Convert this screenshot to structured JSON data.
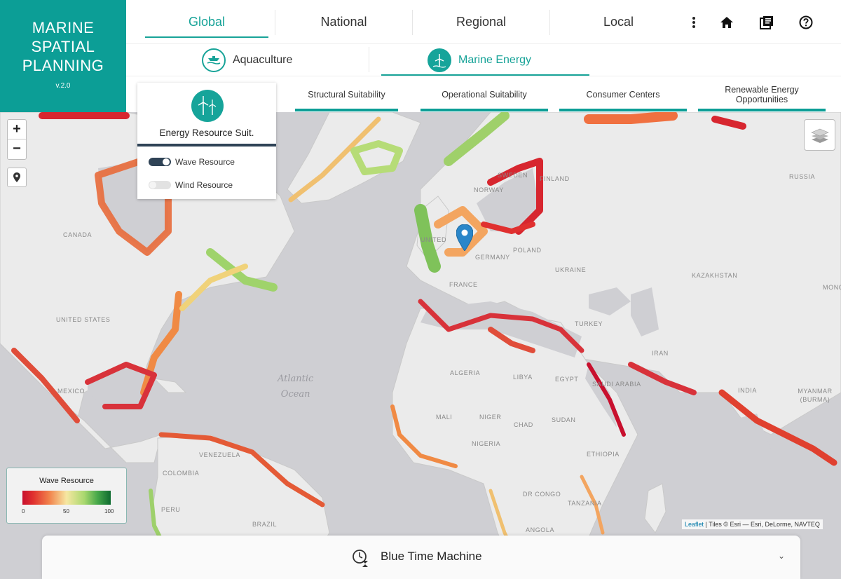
{
  "app": {
    "title_lines": [
      "MARINE",
      "SPATIAL",
      "PLANNING"
    ],
    "version": "v.2.0"
  },
  "scale_tabs": [
    {
      "label": "Global",
      "active": true
    },
    {
      "label": "National",
      "active": false
    },
    {
      "label": "Regional",
      "active": false
    },
    {
      "label": "Local",
      "active": false
    }
  ],
  "nav_icons": [
    "more-vertical-icon",
    "home-icon",
    "library-icon",
    "help-icon"
  ],
  "sectors": [
    {
      "label": "Aquaculture",
      "icon": "aquaculture-icon",
      "active": false
    },
    {
      "label": "Marine Energy",
      "icon": "wind-turbine-icon",
      "active": true
    }
  ],
  "sub_tabs": [
    {
      "label": "Structural Suitability"
    },
    {
      "label": "Operational Suitability"
    },
    {
      "label": "Consumer Centers"
    },
    {
      "label": "Renewable Energy Opportunities"
    }
  ],
  "energy_card": {
    "title": "Energy Resource Suit.",
    "toggles": [
      {
        "label": "Wave Resource",
        "on": true
      },
      {
        "label": "Wind Resource",
        "on": false
      }
    ]
  },
  "zoom": {
    "in": "+",
    "out": "−"
  },
  "legend": {
    "title": "Wave Resource",
    "ticks": [
      "0",
      "50",
      "100"
    ],
    "colors": [
      "#c8102e",
      "#f1804a",
      "#f6e7a2",
      "#a9d86e",
      "#0d6a2f"
    ]
  },
  "map": {
    "ocean": [
      "Atlantic",
      "Ocean"
    ],
    "labels": [
      "CANADA",
      "UNITED STATES",
      "MEXICO",
      "VENEZUELA",
      "COLOMBIA",
      "PERU",
      "BRAZIL",
      "SWEDEN",
      "NORWAY",
      "FINLAND",
      "RUSSIA",
      "UNITED KINGDOM",
      "GERMANY",
      "POLAND",
      "UKRAINE",
      "FRANCE",
      "KAZAKHSTAN",
      "MONG",
      "TURKEY",
      "IRAN",
      "ALGERIA",
      "LIBYA",
      "EGYPT",
      "SAUDI ARABIA",
      "INDIA",
      "MYANMAR (BURMA)",
      "MALI",
      "NIGER",
      "CHAD",
      "SUDAN",
      "NIGERIA",
      "ETHIOPIA",
      "DR CONGO",
      "TANZANIA",
      "ANGOLA"
    ]
  },
  "attribution": {
    "leaflet": "Leaflet",
    "tiles": "| Tiles © Esri — Esri, DeLorme, NAVTEQ"
  },
  "time_machine": {
    "label": "Blue Time Machine"
  }
}
